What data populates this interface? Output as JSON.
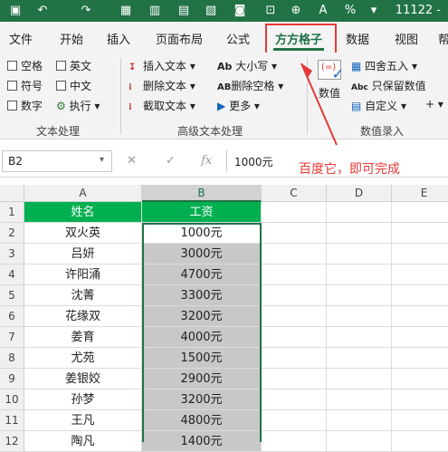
{
  "titlebar": {
    "title": "11122 -"
  },
  "tabs": [
    "文件",
    "开始",
    "插入",
    "页面布局",
    "公式",
    "方方格子",
    "数据",
    "视图",
    "帮"
  ],
  "ribbon": {
    "checks": [
      "空格",
      "英文",
      "符号",
      "中文",
      "数字",
      "执行"
    ],
    "group1": "文本处理",
    "adv": [
      "插入文本",
      "删除文本",
      "截取文本",
      "大小写",
      "删除空格",
      "更多"
    ],
    "group2": "高级文本处理",
    "round": "四舍五入",
    "keep": "只保留数值",
    "custom": "自定义",
    "number": "数值",
    "group3": "数值录入"
  },
  "formula": {
    "namebox": "B2",
    "value": "1000元",
    "fx": "fx"
  },
  "annotation": "百度它，即可完成",
  "columns": [
    "A",
    "B",
    "C",
    "D",
    "E"
  ],
  "header": {
    "a": "姓名",
    "b": "工资"
  },
  "rows": [
    {
      "num": "1",
      "a": "",
      "b": ""
    },
    {
      "num": "2",
      "a": "双火英",
      "b": "1000元"
    },
    {
      "num": "3",
      "a": "吕妍",
      "b": "3000元"
    },
    {
      "num": "4",
      "a": "许阳涌",
      "b": "4700元"
    },
    {
      "num": "5",
      "a": "沈菁",
      "b": "3300元"
    },
    {
      "num": "6",
      "a": "花缘双",
      "b": "3200元"
    },
    {
      "num": "7",
      "a": "姜育",
      "b": "4000元"
    },
    {
      "num": "8",
      "a": "尤苑",
      "b": "1500元"
    },
    {
      "num": "9",
      "a": "姜银姣",
      "b": "2900元"
    },
    {
      "num": "10",
      "a": "孙梦",
      "b": "3200元"
    },
    {
      "num": "11",
      "a": "王凡",
      "b": "4800元"
    },
    {
      "num": "12",
      "a": "陶凡",
      "b": "1400元"
    }
  ]
}
